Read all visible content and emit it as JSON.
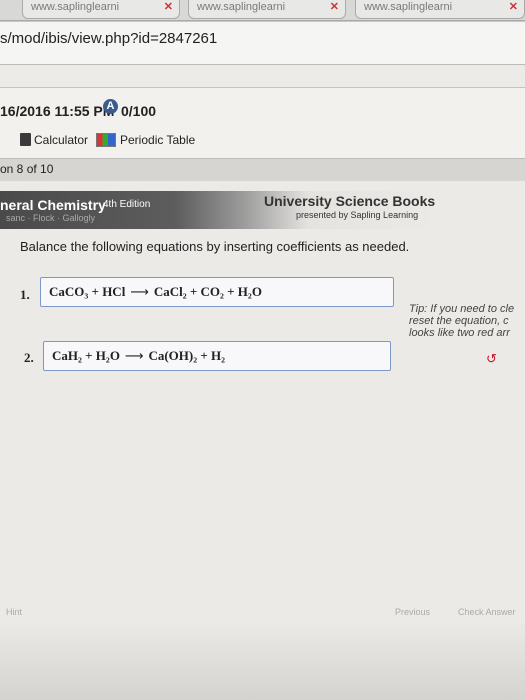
{
  "browser": {
    "tabs": [
      {
        "label": "www.saplinglearni"
      },
      {
        "label": "www.saplinglearni"
      },
      {
        "label": "www.saplinglearni"
      }
    ],
    "tab_close_glyph": "✕",
    "url": "s/mod/ibis/view.php?id=2847261"
  },
  "assignment": {
    "due": "16/2016 11:55 PM",
    "score_badge": "A",
    "score": "0/100",
    "tools": {
      "calculator": "Calculator",
      "periodic_table": "Periodic Table"
    },
    "question_nav": "on 8 of 10"
  },
  "banner": {
    "title": "neral Chemistry",
    "edition": "4th Edition",
    "subtitle": "sanc · Flock · Gallogly",
    "publisher": "University Science Books",
    "publisher_sub": "presented by Sapling Learning"
  },
  "question": {
    "instructions": "Balance the following equations by inserting coefficients as needed.",
    "items": [
      {
        "number": "1.",
        "reactants": "CaCO₃ + HCl",
        "arrow": "⟶",
        "products": "CaCl₂ + CO₂ + H₂O"
      },
      {
        "number": "2.",
        "reactants": "CaH₂ + H₂O",
        "arrow": "⟶",
        "products": "Ca(OH)₂ + H₂"
      }
    ],
    "tip_lines": [
      "Tip: If you need to cle",
      "reset the equation, c",
      "looks like two red arr"
    ],
    "reset_icon_glyph": "↺"
  },
  "footer": {
    "hint": "Hint",
    "previous": "Previous",
    "check_answer": "Check Answer"
  }
}
